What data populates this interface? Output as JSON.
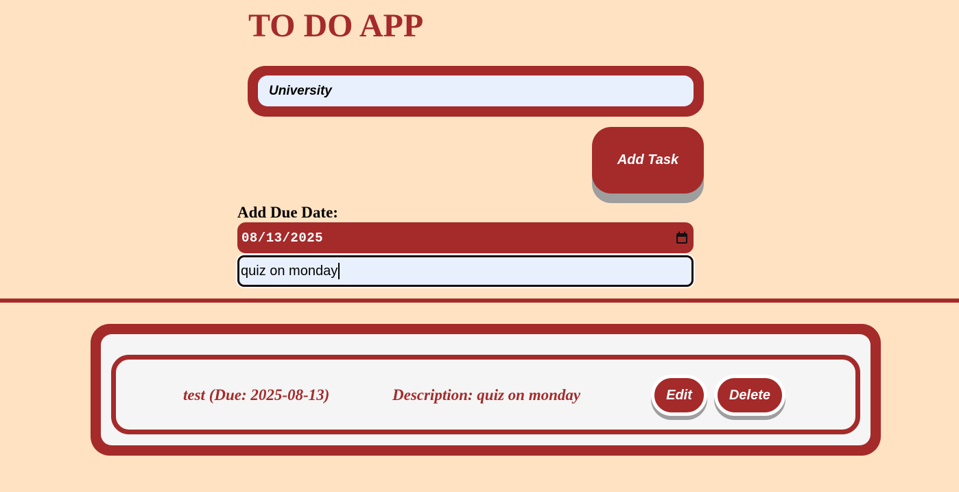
{
  "app": {
    "title": "TO DO APP"
  },
  "form": {
    "task_input_value": "University",
    "add_button_label": "Add Task",
    "due_date_label": "Add Due Date:",
    "due_date_value": "08/13/2025",
    "description_value": "quiz on monday"
  },
  "tasks": [
    {
      "name_due": "test (Due: 2025-08-13)",
      "description": "Description: quiz on monday",
      "edit_label": "Edit",
      "delete_label": "Delete"
    }
  ],
  "colors": {
    "background": "#FFE2C2",
    "accent": "#A52A2A",
    "input_fill": "#E8F0FE",
    "list_fill": "#F5F5F5",
    "shadow": "#9E9E9E"
  },
  "icons": {
    "date_picker": "calendar-icon"
  }
}
